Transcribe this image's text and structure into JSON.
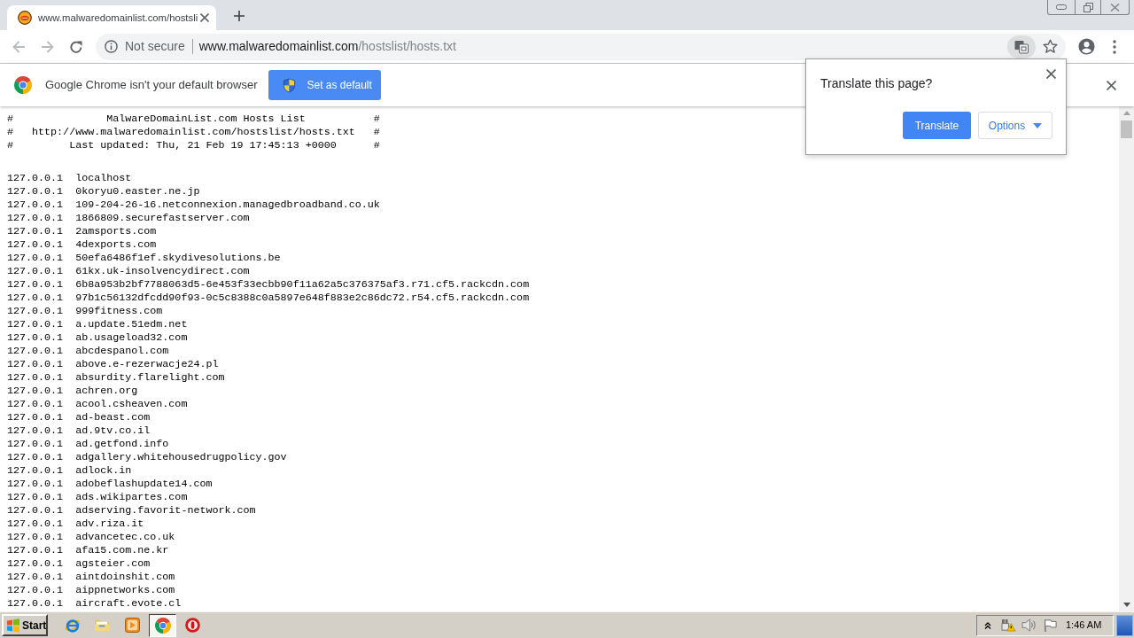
{
  "tabs": [
    {
      "title": "www.malwaredomainlist.com/hostsli",
      "selected": true
    }
  ],
  "address_bar": {
    "security_label": "Not secure",
    "url_host": "www.malwaredomainlist.com",
    "url_path": "/hostslist/hosts.txt"
  },
  "infobar": {
    "message": "Google Chrome isn't your default browser",
    "button": "Set as default"
  },
  "translate_popup": {
    "title": "Translate this page?",
    "translate_button": "Translate",
    "options_button": "Options"
  },
  "page": {
    "header_lines": [
      "#               MalwareDomainList.com Hosts List           #",
      "#   http://www.malwaredomainlist.com/hostslist/hosts.txt   #",
      "#         Last updated: Thu, 21 Feb 19 17:45:13 +0000      #"
    ],
    "lines": [
      "127.0.0.1  localhost",
      "127.0.0.1  0koryu0.easter.ne.jp",
      "127.0.0.1  109-204-26-16.netconnexion.managedbroadband.co.uk",
      "127.0.0.1  1866809.securefastserver.com",
      "127.0.0.1  2amsports.com",
      "127.0.0.1  4dexports.com",
      "127.0.0.1  50efa6486f1ef.skydivesolutions.be",
      "127.0.0.1  61kx.uk-insolvencydirect.com",
      "127.0.0.1  6b8a953b2bf7788063d5-6e453f33ecbb90f11a62a5c376375af3.r71.cf5.rackcdn.com",
      "127.0.0.1  97b1c56132dfcdd90f93-0c5c8388c0a5897e648f883e2c86dc72.r54.cf5.rackcdn.com",
      "127.0.0.1  999fitness.com",
      "127.0.0.1  a.update.51edm.net",
      "127.0.0.1  ab.usageload32.com",
      "127.0.0.1  abcdespanol.com",
      "127.0.0.1  above.e-rezerwacje24.pl",
      "127.0.0.1  absurdity.flarelight.com",
      "127.0.0.1  achren.org",
      "127.0.0.1  acool.csheaven.com",
      "127.0.0.1  ad-beast.com",
      "127.0.0.1  ad.9tv.co.il",
      "127.0.0.1  ad.getfond.info",
      "127.0.0.1  adgallery.whitehousedrugpolicy.gov",
      "127.0.0.1  adlock.in",
      "127.0.0.1  adobeflashupdate14.com",
      "127.0.0.1  ads.wikipartes.com",
      "127.0.0.1  adserving.favorit-network.com",
      "127.0.0.1  adv.riza.it",
      "127.0.0.1  advancetec.co.uk",
      "127.0.0.1  afa15.com.ne.kr",
      "127.0.0.1  agsteier.com",
      "127.0.0.1  aintdoinshit.com",
      "127.0.0.1  aippnetworks.com",
      "127.0.0.1  aircraft.evote.cl"
    ]
  },
  "taskbar": {
    "start_label": "Start",
    "apps": [
      {
        "kind": "browser",
        "selected": false
      },
      {
        "kind": "folder",
        "selected": false
      },
      {
        "kind": "media",
        "selected": false
      },
      {
        "kind": "chrome",
        "selected": true
      },
      {
        "kind": "ring",
        "selected": false
      }
    ],
    "clock": "1:46 AM"
  }
}
